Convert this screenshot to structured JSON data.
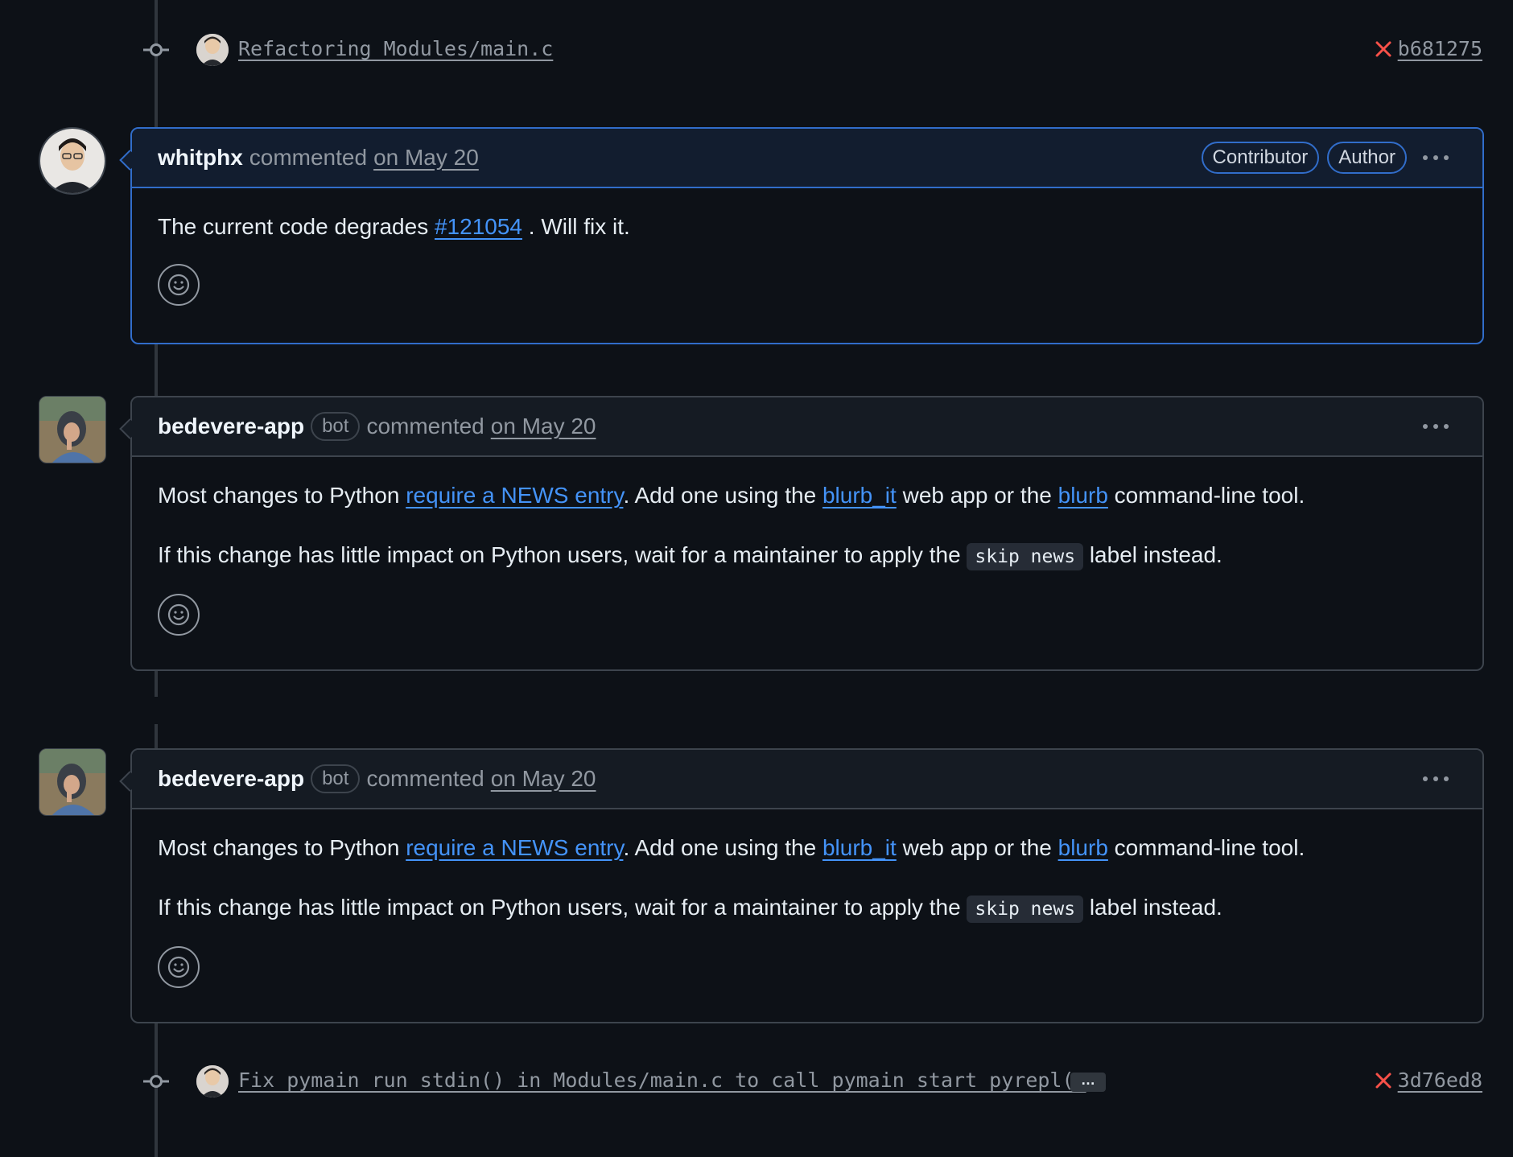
{
  "commits": [
    {
      "message": "Refactoring Modules/main.c",
      "sha": "b681275",
      "status_icon": "x-icon",
      "status_color": "#f85149",
      "has_ellipsis": false
    },
    {
      "message": "Fix pymain_run_stdin() in Modules/main.c to call pymain_start_pyrepl(…",
      "sha": "3d76ed8",
      "status_icon": "x-icon",
      "status_color": "#f85149",
      "has_ellipsis": true,
      "ellipsis": "…"
    }
  ],
  "comments": [
    {
      "author": "whitphx",
      "action": "commented",
      "date": "on May 20",
      "badges": [
        "Contributor",
        "Author"
      ],
      "highlighted": true,
      "body": {
        "text_before": "The current code degrades ",
        "issue_link": "#121054",
        "text_after": " . Will fix it."
      }
    },
    {
      "author": "bedevere-app",
      "bot_badge": "bot",
      "action": "commented",
      "date": "on May 20",
      "highlighted": false,
      "body": {
        "p1_prefix": "Most changes to Python ",
        "p1_link1": "require a NEWS entry",
        "p1_mid1": ". Add one using the ",
        "p1_link2": "blurb_it",
        "p1_mid2": " web app or the ",
        "p1_link3": "blurb",
        "p1_suffix": " command-line tool.",
        "p2_prefix": "If this change has little impact on Python users, wait for a maintainer to apply the ",
        "p2_code": "skip news",
        "p2_suffix": " label instead."
      }
    },
    {
      "author": "bedevere-app",
      "bot_badge": "bot",
      "action": "commented",
      "date": "on May 20",
      "highlighted": false,
      "body": {
        "p1_prefix": "Most changes to Python ",
        "p1_link1": "require a NEWS entry",
        "p1_mid1": ". Add one using the ",
        "p1_link2": "blurb_it",
        "p1_mid2": " web app or the ",
        "p1_link3": "blurb",
        "p1_suffix": " command-line tool.",
        "p2_prefix": "If this change has little impact on Python users, wait for a maintainer to apply the ",
        "p2_code": "skip news",
        "p2_suffix": " label instead."
      }
    }
  ],
  "colors": {
    "background": "#0d1117",
    "link": "#4493f8",
    "highlight_border": "#316dca",
    "muted": "#9198a1"
  }
}
